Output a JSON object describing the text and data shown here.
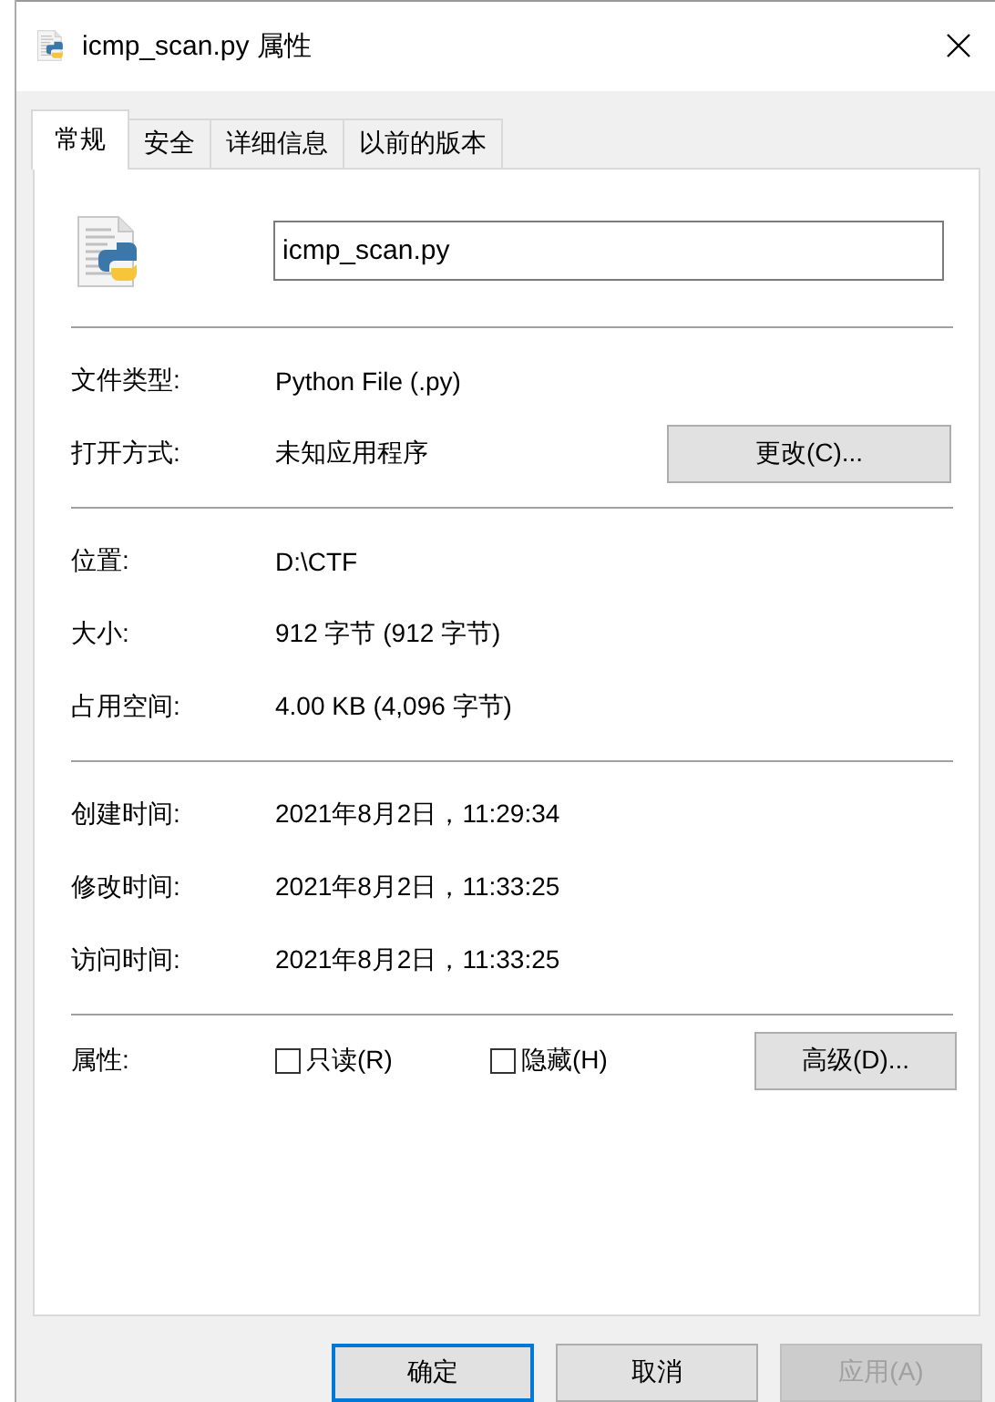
{
  "window": {
    "title": "icmp_scan.py 属性"
  },
  "tabs": [
    {
      "label": "常规",
      "selected": true
    },
    {
      "label": "安全",
      "selected": false
    },
    {
      "label": "详细信息",
      "selected": false
    },
    {
      "label": "以前的版本",
      "selected": false
    }
  ],
  "file_name": {
    "value": "icmp_scan.py"
  },
  "sections": [
    {
      "rows": [
        {
          "label": "文件类型:",
          "value": "Python File (.py)"
        },
        {
          "label": "打开方式:",
          "value": "未知应用程序",
          "button": "更改(C)..."
        }
      ]
    },
    {
      "rows": [
        {
          "label": "位置:",
          "value": "D:\\CTF"
        },
        {
          "label": "大小:",
          "value": "912 字节 (912 字节)"
        },
        {
          "label": "占用空间:",
          "value": "4.00 KB (4,096 字节)"
        }
      ]
    },
    {
      "rows": [
        {
          "label": "创建时间:",
          "value": "2021年8月2日，11:29:34"
        },
        {
          "label": "修改时间:",
          "value": "2021年8月2日，11:33:25"
        },
        {
          "label": "访问时间:",
          "value": "2021年8月2日，11:33:25"
        }
      ]
    }
  ],
  "attributes": {
    "label": "属性:",
    "checkboxes": [
      {
        "label": "只读(R)",
        "checked": false
      },
      {
        "label": "隐藏(H)",
        "checked": false
      }
    ],
    "button": "高级(D)..."
  },
  "buttons": [
    {
      "label": "确定",
      "default": true,
      "disabled": false
    },
    {
      "label": "取消",
      "default": false,
      "disabled": false
    },
    {
      "label": "应用(A)",
      "default": false,
      "disabled": true
    }
  ]
}
